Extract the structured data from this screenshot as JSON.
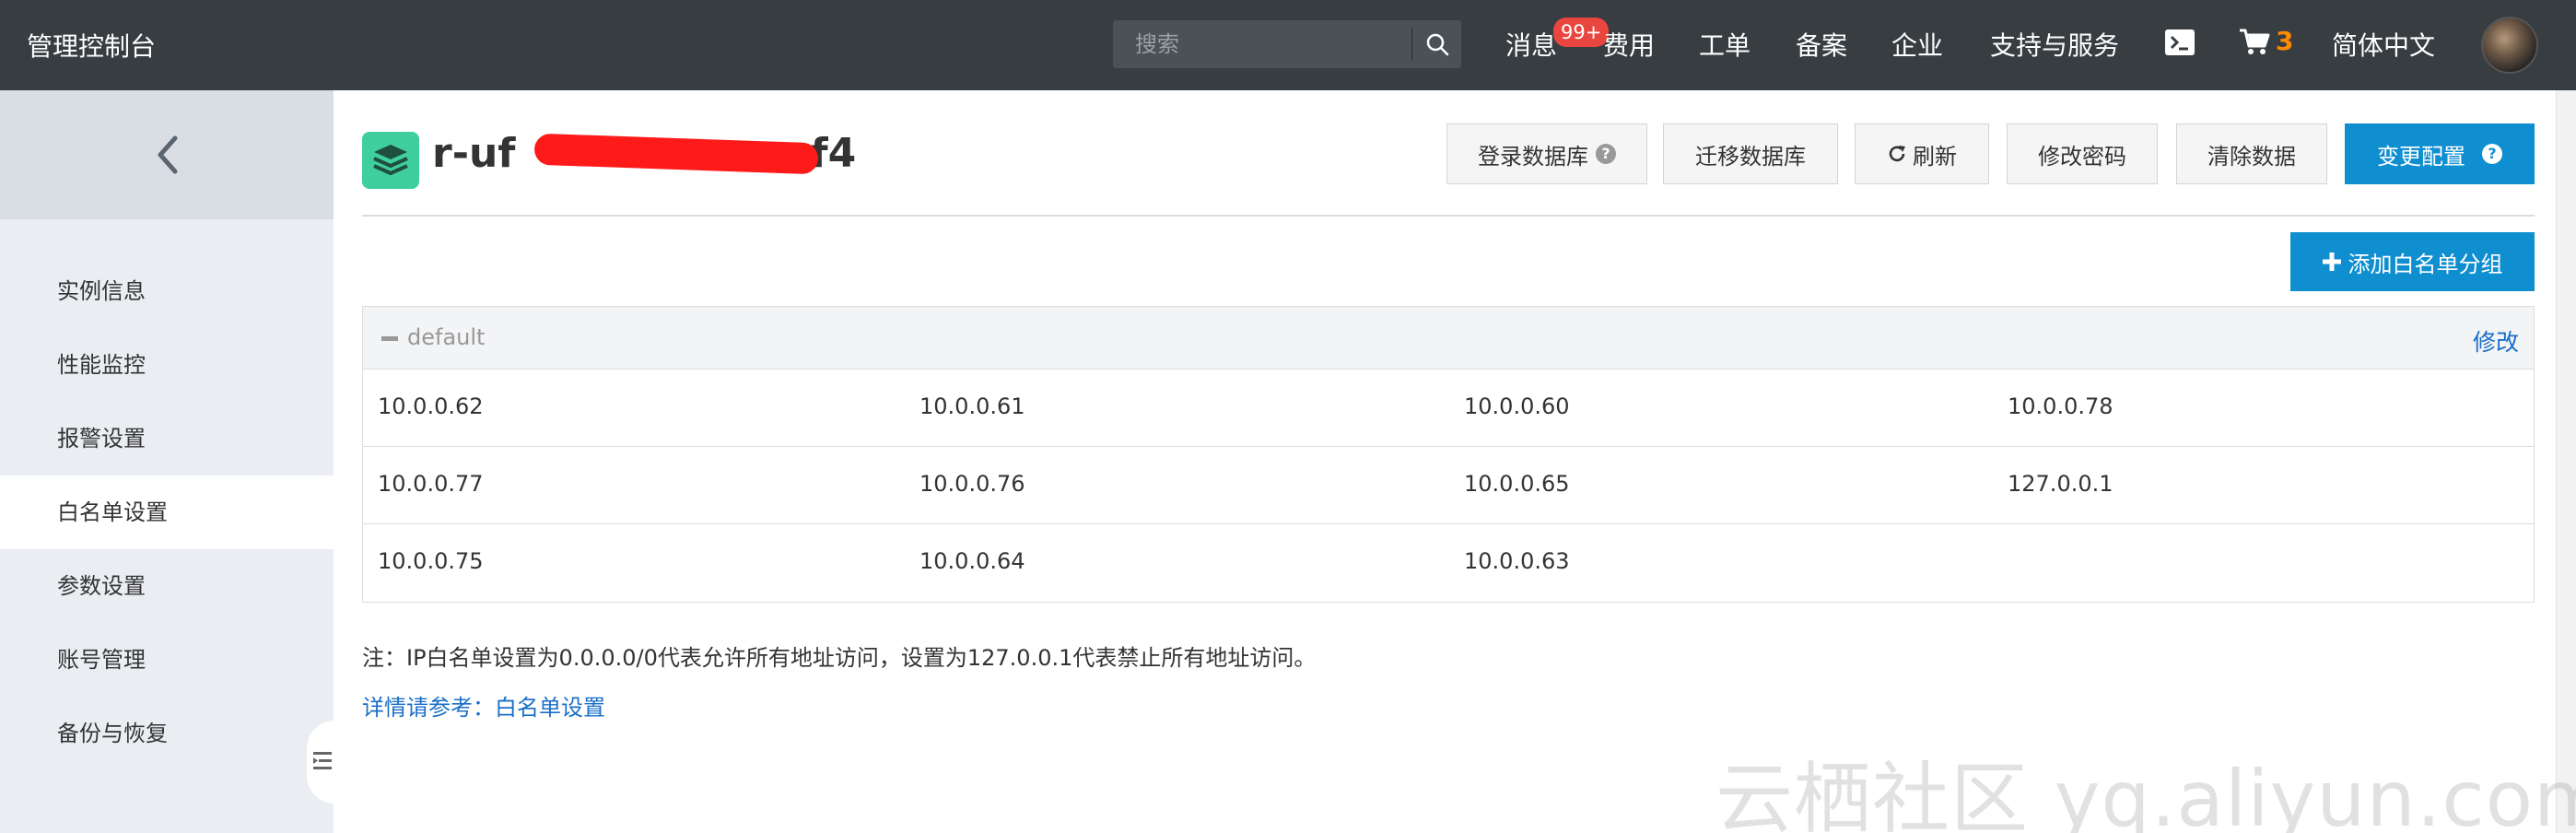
{
  "topbar": {
    "brand": "管理控制台",
    "search_placeholder": "搜索",
    "nav": {
      "messages": "消息",
      "messages_badge": "99+",
      "billing": "费用",
      "tickets": "工单",
      "icp": "备案",
      "enterprise": "企业",
      "support": "支持与服务",
      "cart_count": "3",
      "language": "简体中文"
    }
  },
  "sidebar": {
    "items": [
      {
        "label": "实例信息"
      },
      {
        "label": "性能监控"
      },
      {
        "label": "报警设置"
      },
      {
        "label": "白名单设置",
        "active": true
      },
      {
        "label": "参数设置"
      },
      {
        "label": "账号管理"
      },
      {
        "label": "备份与恢复"
      }
    ]
  },
  "instance": {
    "title_visible": "r-uf",
    "title_suffix": "f4"
  },
  "actions": {
    "login_db": "登录数据库",
    "migrate_db": "迁移数据库",
    "refresh": "刷新",
    "change_password": "修改密码",
    "clear_data": "清除数据",
    "change_config": "变更配置",
    "add_whitelist_group": "添加白名单分组"
  },
  "whitelist_group": {
    "name": "default",
    "edit": "修改",
    "rows": [
      [
        "10.0.0.62",
        "10.0.0.61",
        "10.0.0.60",
        "10.0.0.78"
      ],
      [
        "10.0.0.77",
        "10.0.0.76",
        "10.0.0.65",
        "127.0.0.1"
      ],
      [
        "10.0.0.75",
        "10.0.0.64",
        "10.0.0.63",
        ""
      ]
    ]
  },
  "note": "注：IP白名单设置为0.0.0.0/0代表允许所有地址访问，设置为127.0.0.1代表禁止所有地址访问。",
  "reference": {
    "prefix": "详情请参考：",
    "link": "白名单设置"
  },
  "watermark": "云栖社区 yq.aliyun.com",
  "colors": {
    "topbar_bg": "#373d41",
    "primary": "#0f8fd0",
    "link": "#1a6fc7",
    "badge": "#e8463f",
    "cart": "#ff8a00",
    "db_icon": "#3fcf9e",
    "redaction": "#ff1a1a"
  }
}
